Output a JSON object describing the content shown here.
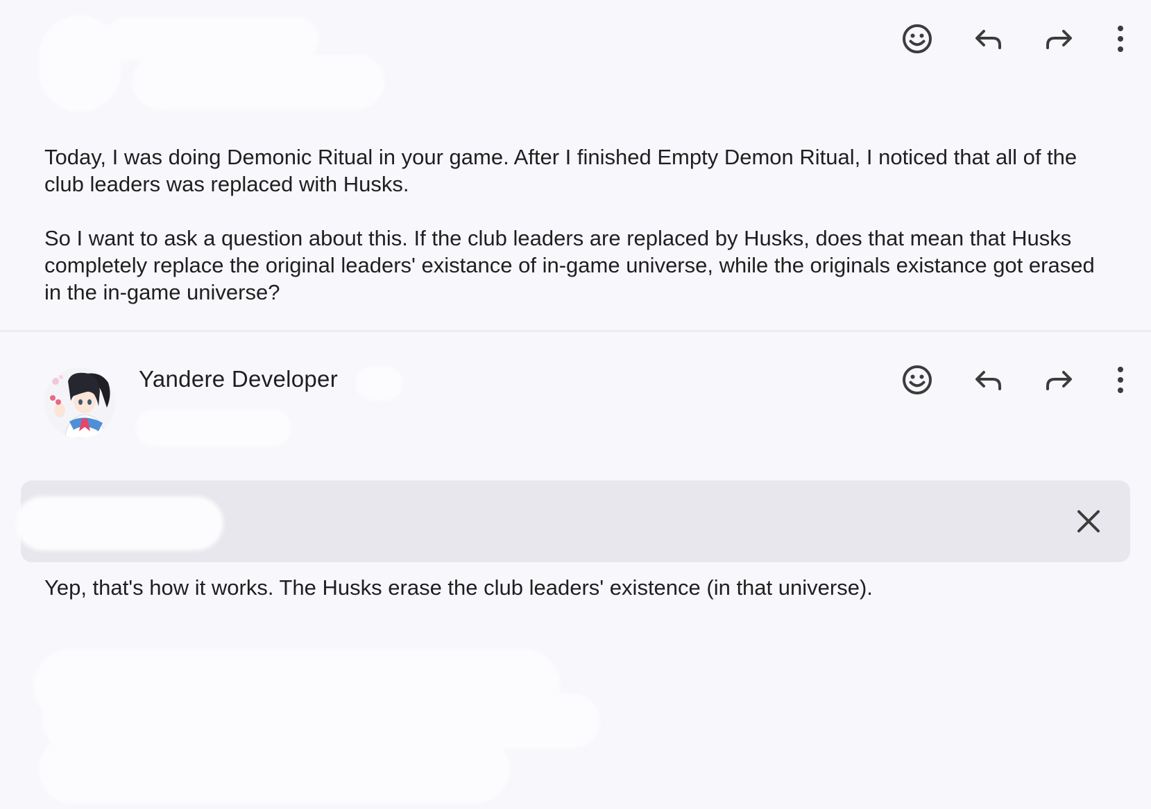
{
  "message1": {
    "paragraphs": [
      "Today, I was doing Demonic Ritual in your game. After I finished Empty Demon Ritual, I noticed that all of the club leaders was replaced with Husks.",
      "So I want to ask a question about this. If the club leaders are replaced by Husks, does that mean that Husks completely replace the original leaders' existance of in-game universe, while the originals existance got erased in the in-game universe?"
    ]
  },
  "message2": {
    "sender": "Yandere Developer",
    "reply": "Yep, that's how it works. The Husks erase the club leaders' existence (in that universe)."
  },
  "icons": {
    "emoji": "smiley-face-icon",
    "reply": "reply-arrow-icon",
    "forward": "forward-arrow-icon",
    "more": "more-vertical-icon",
    "close": "close-icon"
  },
  "colors": {
    "background": "#f7f7fc",
    "text": "#1f1f1f",
    "banner": "#e7e7ed",
    "icon": "#3c3c3c"
  }
}
